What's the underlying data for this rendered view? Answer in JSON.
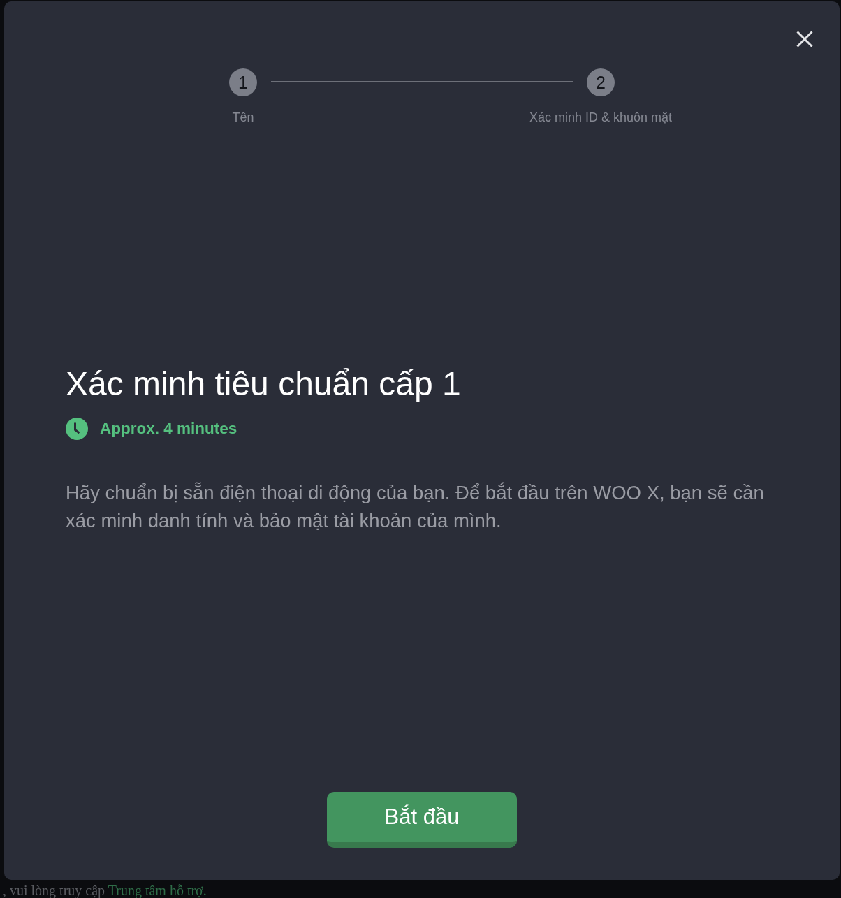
{
  "dialog": {
    "steps": [
      {
        "number": "1",
        "label": "Tên"
      },
      {
        "number": "2",
        "label": "Xác minh ID & khuôn mặt"
      }
    ],
    "title": "Xác minh tiêu chuẩn cấp 1",
    "duration": "Approx. 4 minutes",
    "description": "Hãy chuẩn bị sẵn điện thoại di động của bạn. Để bắt đầu trên WOO X, bạn sẽ cần xác minh danh tính và bảo mật tài khoản của mình.",
    "primary_button": "Bắt đầu"
  },
  "background_page": {
    "text": ", vui lòng truy cập ",
    "link": "Trung tâm hỗ trợ."
  }
}
